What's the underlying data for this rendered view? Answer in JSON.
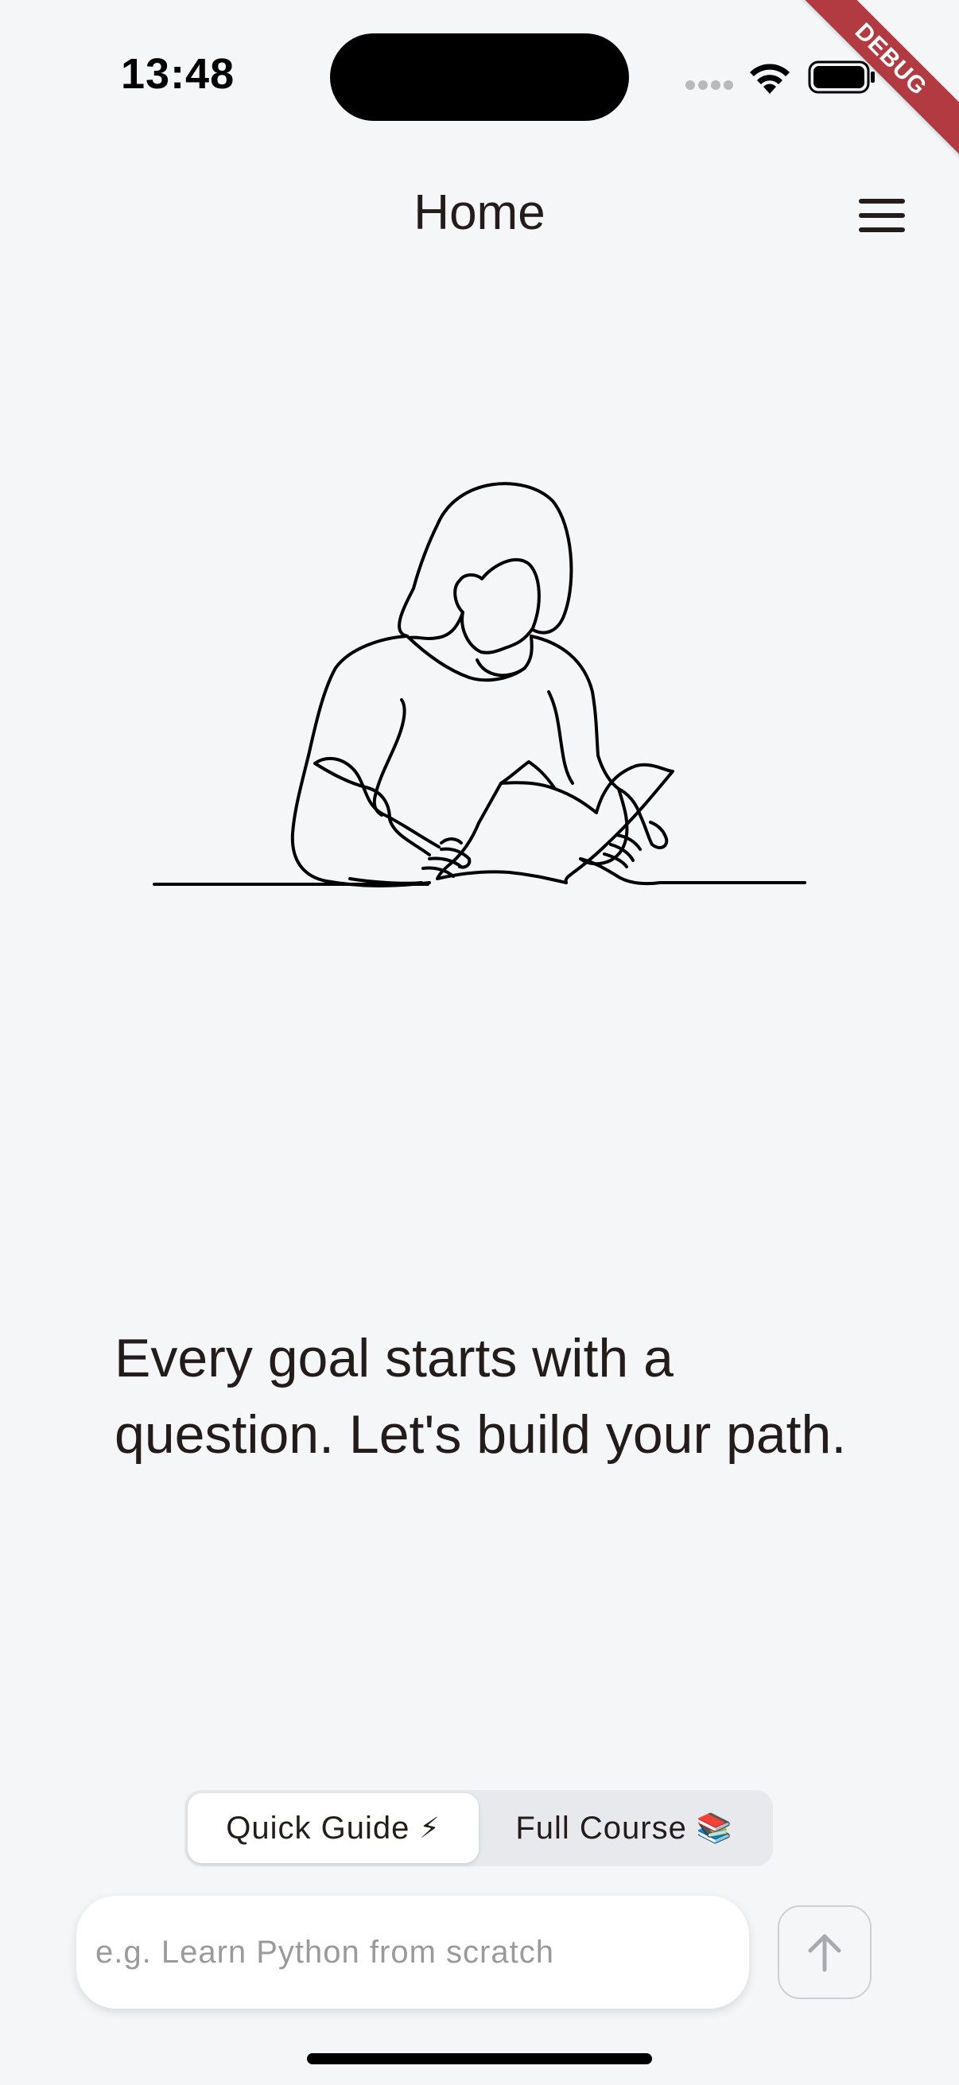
{
  "status_bar": {
    "time": "13:48",
    "debug_label": "DEBUG"
  },
  "app_bar": {
    "title": "Home",
    "menu_icon": "hamburger-menu-icon"
  },
  "illustration": {
    "icon": "woman-reading-book-line-art"
  },
  "tagline": "Every goal starts with a question. Let's build your path.",
  "mode_toggle": {
    "selected": "quick_guide",
    "options": [
      {
        "id": "quick_guide",
        "label": "Quick Guide",
        "emoji": "⚡"
      },
      {
        "id": "full_course",
        "label": "Full Course",
        "emoji": "📚"
      }
    ]
  },
  "prompt": {
    "value": "",
    "placeholder": "e.g. Learn Python from scratch"
  },
  "send": {
    "icon": "arrow-up-icon"
  },
  "colors": {
    "background": "#f5f6f8",
    "text": "#231c1a",
    "debug_ribbon": "#b13b40",
    "segment_track": "#e8e9ec",
    "placeholder": "#9a9a9c"
  }
}
